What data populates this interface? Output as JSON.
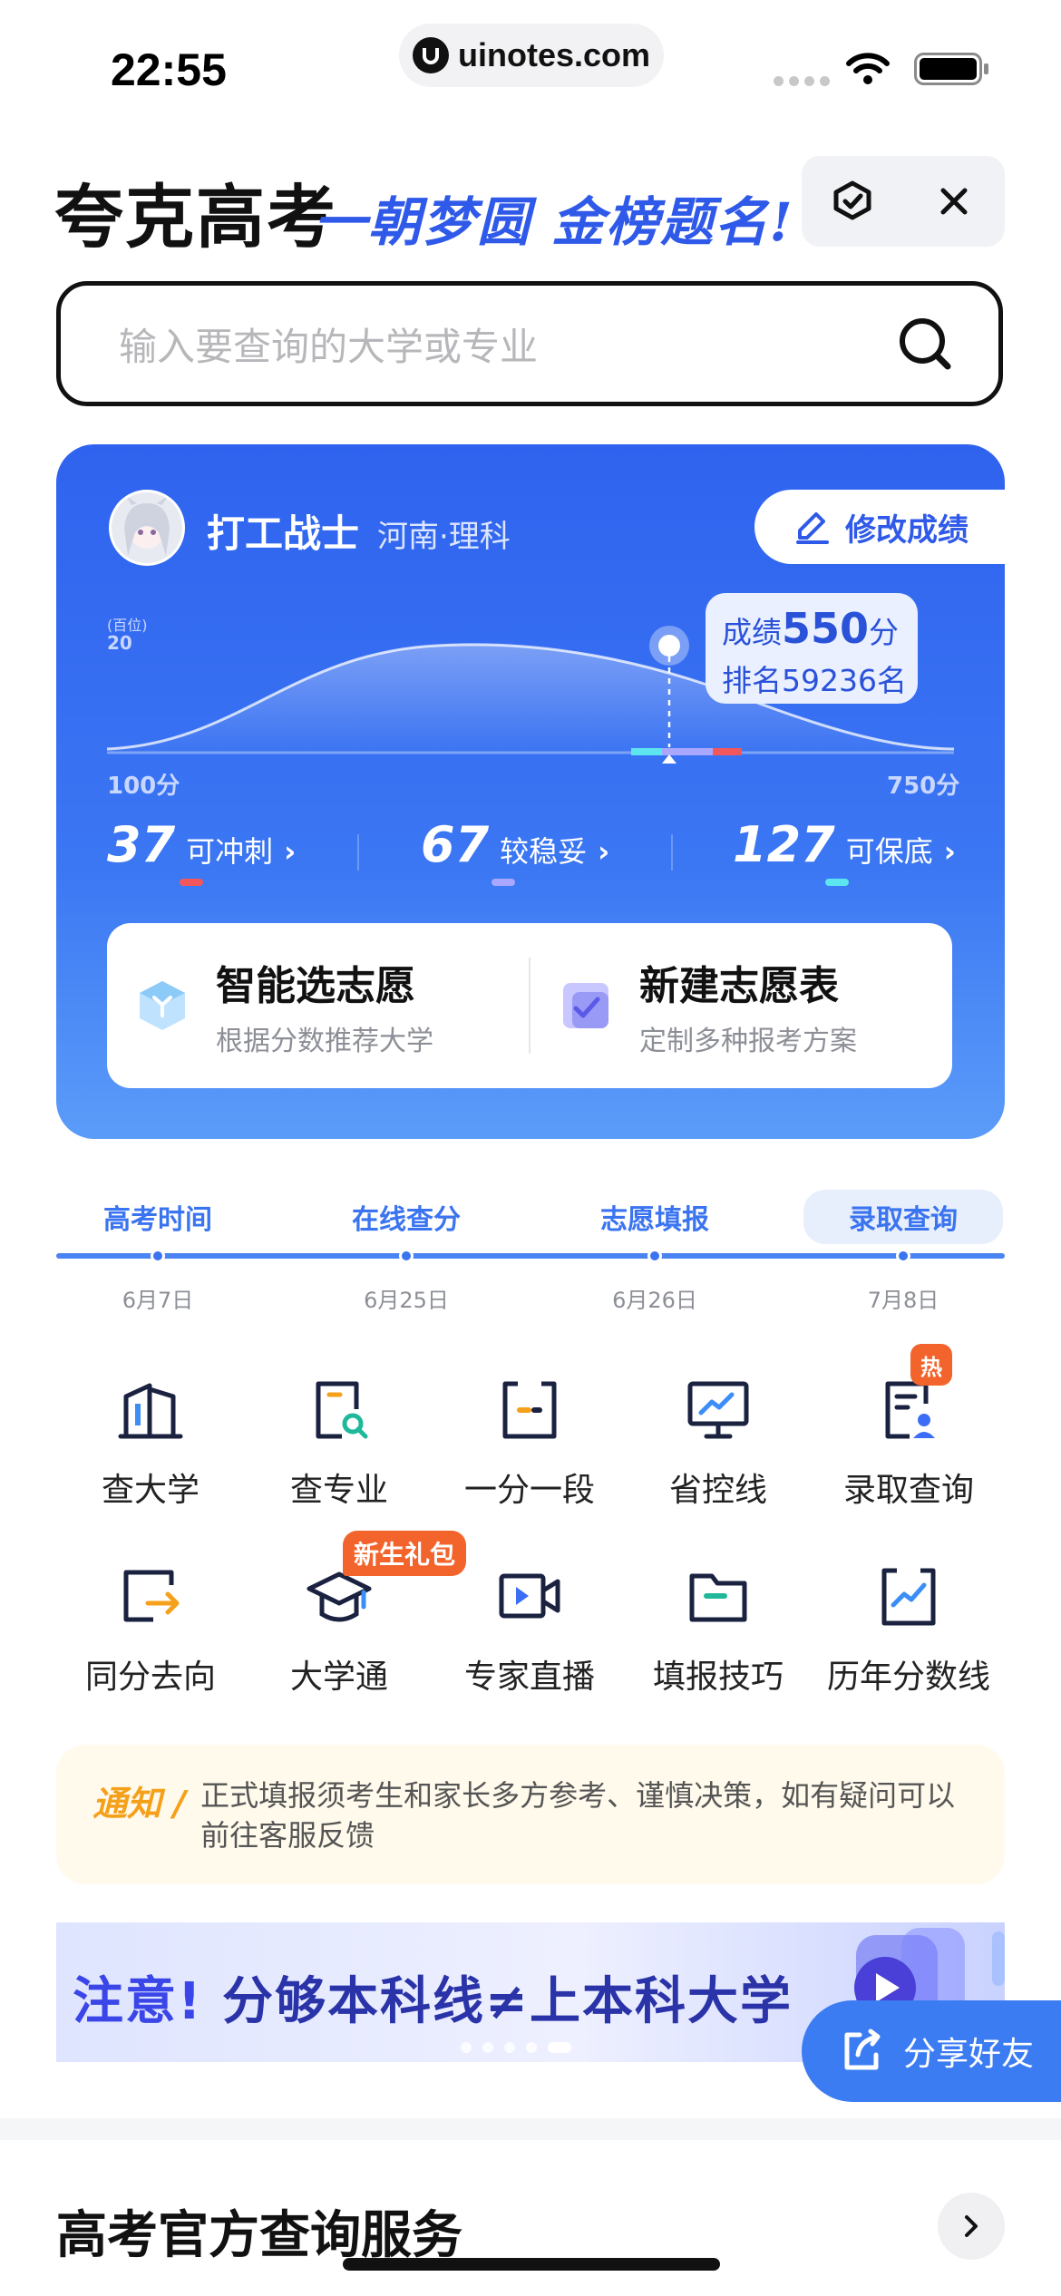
{
  "status": {
    "time": "22:55",
    "url": "uinotes.com"
  },
  "header": {
    "title": "夸克高考",
    "slogan": "一朝梦圆 金榜题名!"
  },
  "search": {
    "placeholder": "输入要查询的大学或专业"
  },
  "profile": {
    "name": "打工战士",
    "region": "河南·理科",
    "edit_label": "修改成绩",
    "axis_unit": "(百位)",
    "axis_top": "20",
    "axis_min": "100分",
    "axis_max": "750分",
    "score_prefix": "成绩",
    "score": "550",
    "score_suffix": "分",
    "rank": "排名59236名"
  },
  "stats": [
    {
      "count": "37",
      "label": "可冲刺",
      "color": "#f2585b"
    },
    {
      "count": "67",
      "label": "较稳妥",
      "color": "#a9a7ff"
    },
    {
      "count": "127",
      "label": "可保底",
      "color": "#5ee6f0"
    }
  ],
  "actions": [
    {
      "title": "智能选志愿",
      "subtitle": "根据分数推荐大学"
    },
    {
      "title": "新建志愿表",
      "subtitle": "定制多种报考方案"
    }
  ],
  "timeline": [
    {
      "label": "高考时间",
      "date": "6月7日"
    },
    {
      "label": "在线查分",
      "date": "6月25日"
    },
    {
      "label": "志愿填报",
      "date": "6月26日"
    },
    {
      "label": "录取查询",
      "date": "7月8日"
    }
  ],
  "grid": [
    {
      "label": "查大学",
      "icon": "university-icon"
    },
    {
      "label": "查专业",
      "icon": "major-search-icon"
    },
    {
      "label": "一分一段",
      "icon": "score-segment-icon"
    },
    {
      "label": "省控线",
      "icon": "control-line-icon"
    },
    {
      "label": "录取查询",
      "icon": "admission-icon"
    },
    {
      "label": "同分去向",
      "icon": "same-score-icon"
    },
    {
      "label": "大学通",
      "icon": "graduation-cap-icon"
    },
    {
      "label": "专家直播",
      "icon": "live-video-icon"
    },
    {
      "label": "填报技巧",
      "icon": "folder-icon"
    },
    {
      "label": "历年分数线",
      "icon": "trend-chart-icon"
    }
  ],
  "badges": {
    "hot": "热",
    "gift": "新生礼包"
  },
  "notice": {
    "tag": "通知 /",
    "text": "正式填报须考生和家长多方参考、谨慎决策，如有疑问可以前往客服反馈"
  },
  "banner": {
    "prefix": "注意!",
    "text": "分够本科线≠上本科大学"
  },
  "share": {
    "label": "分享好友"
  },
  "section": {
    "title": "高考官方查询服务"
  },
  "colors": {
    "brand_blue": "#2f63ef",
    "accent_orange": "#f3642c",
    "notice_yellow": "#f5a01a"
  }
}
